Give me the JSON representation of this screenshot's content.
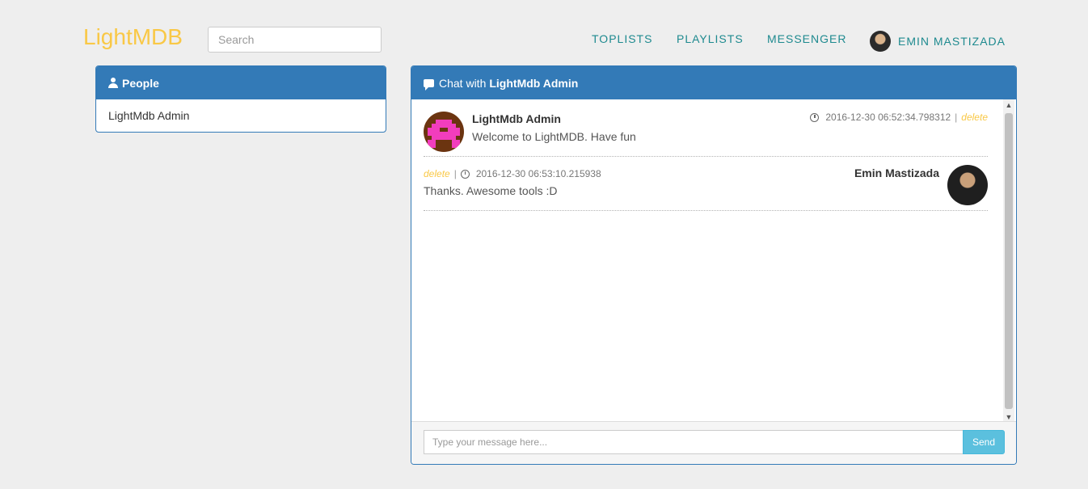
{
  "brand": "LightMDB",
  "search": {
    "placeholder": "Search"
  },
  "nav": {
    "toplists": "TOPLISTS",
    "playlists": "PLAYLISTS",
    "messenger": "MESSENGER",
    "user": "EMIN MASTIZADA"
  },
  "people": {
    "title": "People",
    "items": [
      "LightMdb Admin"
    ]
  },
  "chat": {
    "title_prefix": "Chat with",
    "title_name": "LightMdb Admin",
    "messages": [
      {
        "author": "LightMdb Admin",
        "text": "Welcome to LightMDB. Have fun",
        "timestamp": "2016-12-30 06:52:34.798312",
        "separator": "|",
        "delete": "delete"
      },
      {
        "author": "Emin Mastizada",
        "text": "Thanks. Awesome tools :D",
        "timestamp": "2016-12-30 06:53:10.215938",
        "separator": "|",
        "delete": "delete"
      }
    ],
    "input_placeholder": "Type your message here...",
    "send": "Send"
  },
  "colors": {
    "brand": "#f9c846",
    "nav": "#1e8a8f",
    "panel": "#337ab7",
    "send": "#5bc0de"
  }
}
